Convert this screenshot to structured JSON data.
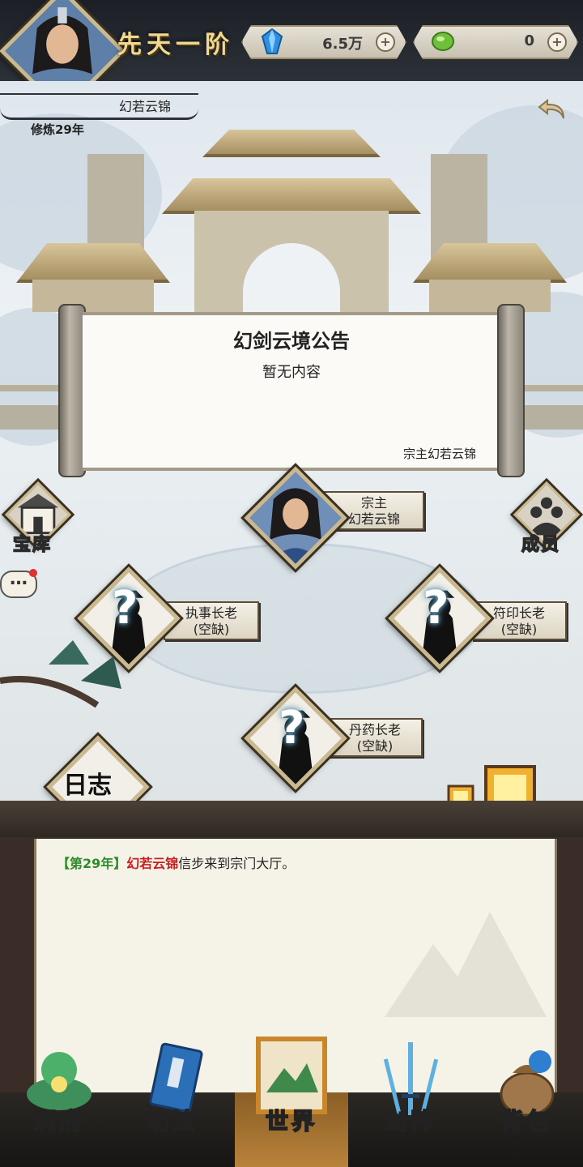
{
  "header": {
    "realm": "先天一阶",
    "spirit_stones": "6.5万",
    "jade": "0",
    "plus_glyph": "+"
  },
  "profile": {
    "sect_name": "幻若云锦",
    "cultivation_years": "修炼29年"
  },
  "notice": {
    "title": "幻剑云境公告",
    "content": "暂无内容",
    "signature": "宗主幻若云锦"
  },
  "side_buttons": {
    "treasury": "宝库",
    "members": "成员",
    "chat_glyph": "…"
  },
  "slots": {
    "leader": {
      "title": "宗主",
      "name": "幻若云锦"
    },
    "deacon": {
      "title": "执事长老",
      "status": "(空缺)"
    },
    "seal": {
      "title": "符印长老",
      "status": "(空缺)"
    },
    "alchemy": {
      "title": "丹药长老",
      "status": "(空缺)"
    },
    "question": "?"
  },
  "log": {
    "badge": "日志",
    "year": "【第29年】",
    "name": "幻若云锦",
    "message": "信步来到宗门大厅。"
  },
  "nav": {
    "cave": "洞府",
    "skills": "功法",
    "world": "世界",
    "sword_array": "剑阵",
    "bag": "背包"
  }
}
